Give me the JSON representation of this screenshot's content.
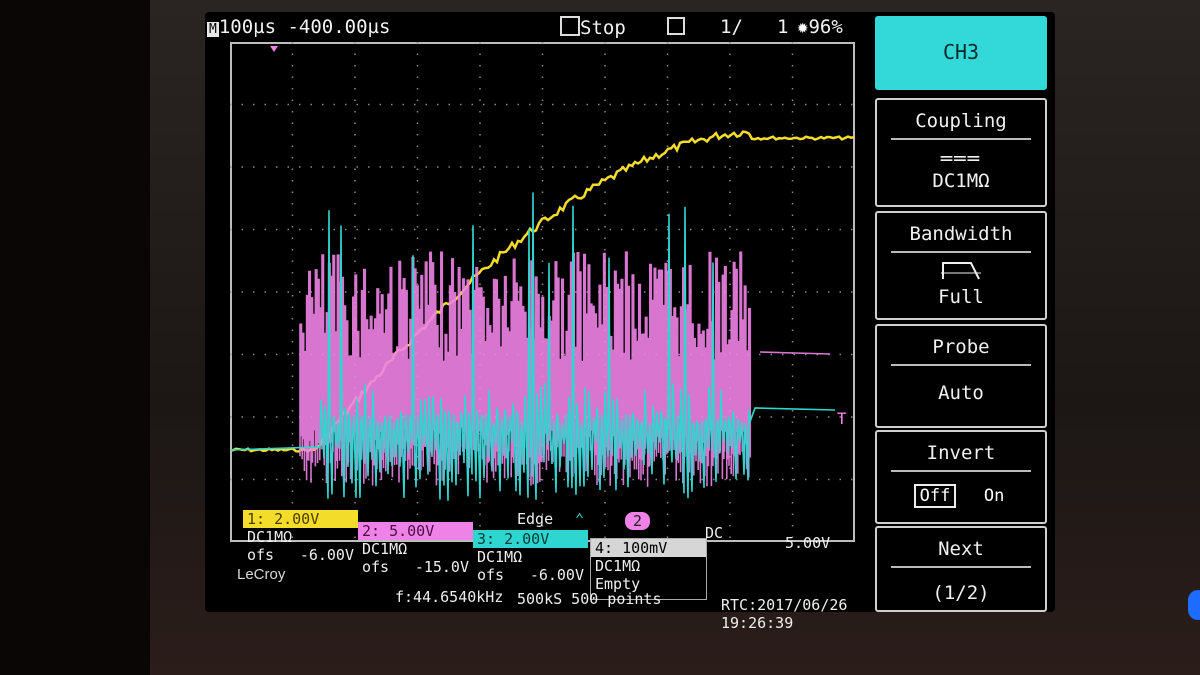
{
  "status": {
    "timebase_badge": "M",
    "timebase": "100µs -400.00µs",
    "run_state": "Stop",
    "acquisition": "1/",
    "count": "1",
    "brightness": "96%"
  },
  "menu": {
    "channel": "CH3",
    "coupling_label": "Coupling",
    "coupling_value": "DC1MΩ",
    "bandwidth_label": "Bandwidth",
    "bandwidth_value": "Full",
    "probe_label": "Probe",
    "probe_value": "Auto",
    "invert_label": "Invert",
    "invert_off": "Off",
    "invert_on": "On",
    "next_label": "Next",
    "next_page": "(1/2)"
  },
  "channels": [
    {
      "head": "1: 2.00V",
      "coupling": "DC1MΩ",
      "ofs_label": "ofs",
      "ofs": "-6.00V",
      "color": "#f3dc2a"
    },
    {
      "head": "2: 5.00V",
      "coupling": "DC1MΩ",
      "ofs_label": "ofs",
      "ofs": "-15.0V",
      "color": "#ee82e6"
    },
    {
      "head": "3: 2.00V",
      "coupling": "DC1MΩ",
      "ofs_label": "ofs",
      "ofs": "-6.00V",
      "color": "#2fd6cf"
    },
    {
      "head": "4: 100mV",
      "coupling": "DC1MΩ",
      "state": "Empty",
      "color": "#d6d6d6"
    }
  ],
  "trigger": {
    "type": "Edge",
    "source": "2",
    "coupling": "DC",
    "level": "5.00V",
    "marker": "T"
  },
  "footer": {
    "brand": "LeCroy",
    "frequency": "f:44.6540kHz",
    "sample_rate": "500kS 500 points",
    "rtc": "RTC:2017/06/26 19:26:39"
  },
  "colors": {
    "ch1": "#f3dc2a",
    "ch2": "#ee82e6",
    "ch3": "#2fd6cf",
    "menu_active": "#33d9d9"
  }
}
